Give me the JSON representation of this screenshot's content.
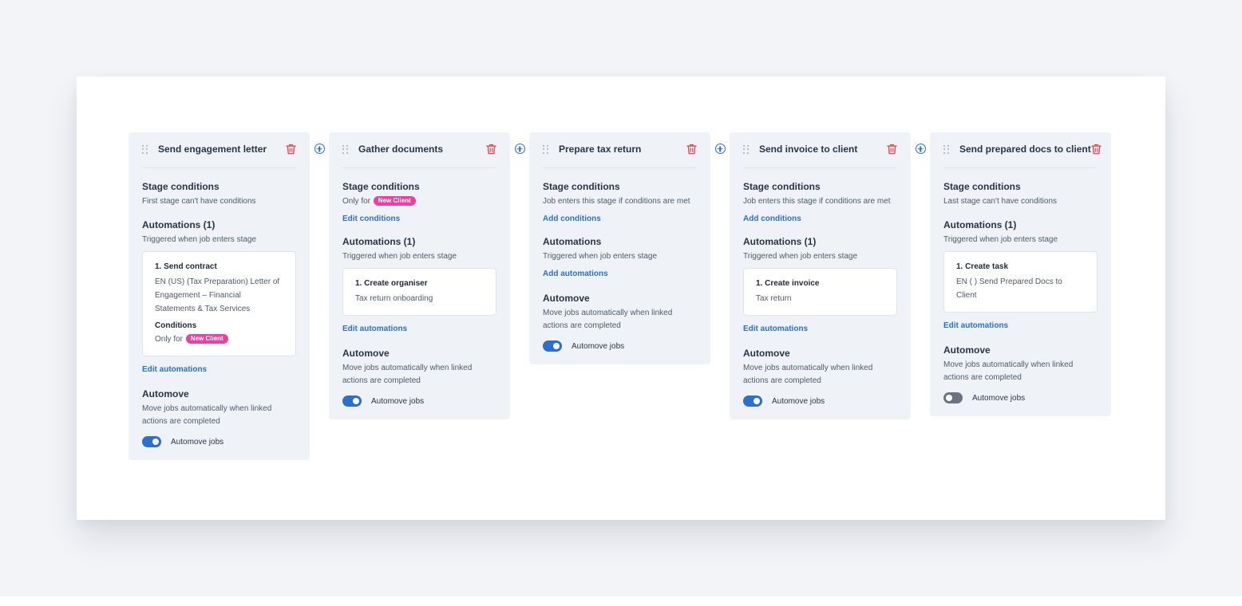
{
  "stages": [
    {
      "title": "Send engagement letter",
      "conditions_title": "Stage conditions",
      "conditions_text": "First stage can't have conditions",
      "automations_title": "Automations (1)",
      "automations_sub": "Triggered when job enters stage",
      "automation": {
        "title": "1. Send contract",
        "desc": "EN (US) (Tax Preparation) Letter of Engagement – Financial Statements & Tax Services",
        "conditions_title": "Conditions",
        "conditions_prefix": "Only for",
        "badge": "New Client"
      },
      "automations_link": "Edit automations",
      "automove_title": "Automove",
      "automove_desc": "Move jobs automatically when linked actions are completed",
      "automove_label": "Automove jobs",
      "automove_on": true
    },
    {
      "title": "Gather documents",
      "conditions_title": "Stage conditions",
      "conditions_prefix": "Only for",
      "conditions_badge": "New Client",
      "conditions_link": "Edit conditions",
      "automations_title": "Automations (1)",
      "automations_sub": "Triggered when job enters stage",
      "automation": {
        "title": "1. Create organiser",
        "desc": "Tax return onboarding"
      },
      "automations_link": "Edit automations",
      "automove_title": "Automove",
      "automove_desc": "Move jobs automatically when linked actions are completed",
      "automove_label": "Automove jobs",
      "automove_on": true
    },
    {
      "title": "Prepare tax return",
      "conditions_title": "Stage conditions",
      "conditions_text": "Job enters this stage if conditions are met",
      "conditions_link": "Add conditions",
      "automations_title": "Automations",
      "automations_sub": "Triggered when job enters stage",
      "automations_link": "Add automations",
      "automove_title": "Automove",
      "automove_desc": "Move jobs automatically when linked actions are completed",
      "automove_label": "Automove jobs",
      "automove_on": true
    },
    {
      "title": "Send invoice to client",
      "conditions_title": "Stage conditions",
      "conditions_text": "Job enters this stage if conditions are met",
      "conditions_link": "Add conditions",
      "automations_title": "Automations (1)",
      "automations_sub": "Triggered when job enters stage",
      "automation": {
        "title": "1. Create invoice",
        "desc": "Tax return"
      },
      "automations_link": "Edit automations",
      "automove_title": "Automove",
      "automove_desc": "Move jobs automatically when linked actions are completed",
      "automove_label": "Automove jobs",
      "automove_on": true
    },
    {
      "title": "Send prepared docs to client",
      "conditions_title": "Stage conditions",
      "conditions_text": "Last stage can't have conditions",
      "automations_title": "Automations (1)",
      "automations_sub": "Triggered when job enters stage",
      "automation": {
        "title": "1. Create task",
        "desc": "EN ( ) Send Prepared Docs to Client"
      },
      "automations_link": "Edit automations",
      "automove_title": "Automove",
      "automove_desc": "Move jobs automatically when linked actions are completed",
      "automove_label": "Automove jobs",
      "automove_on": false
    }
  ],
  "icons": {
    "drag": "drag-handle-icon",
    "delete": "trash-icon",
    "add_stage": "plus-circle-icon"
  },
  "colors": {
    "accent": "#2c6fcf",
    "danger": "#e5484d",
    "badge": "#ee3fa1",
    "stage_bg": "#eff3f8"
  }
}
